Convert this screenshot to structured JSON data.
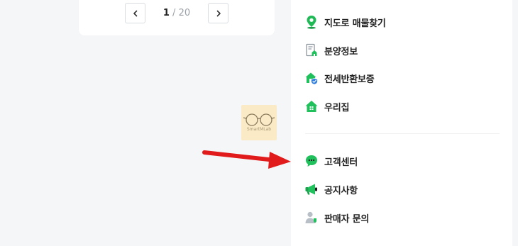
{
  "pagination": {
    "prev_icon": "chevron-left-icon",
    "next_icon": "chevron-right-icon",
    "current_page": "1",
    "separator_total": " / 20"
  },
  "watermark": {
    "text": "SmartMLab"
  },
  "menu": {
    "items": [
      {
        "label": "지도로 매물찾기",
        "icon": "map-pin-icon"
      },
      {
        "label": "분양정보",
        "icon": "building-doc-icon"
      },
      {
        "label": "전세반환보증",
        "icon": "house-shield-icon"
      },
      {
        "label": "우리집",
        "icon": "house-icon"
      },
      {
        "label": "고객센터",
        "icon": "chat-bubble-icon"
      },
      {
        "label": "공지사항",
        "icon": "megaphone-icon"
      },
      {
        "label": "판매자 문의",
        "icon": "seller-person-icon"
      }
    ]
  },
  "colors": {
    "accent_green": "#20c05c",
    "arrow_red": "#e11b1b",
    "background": "#f5f6f8"
  }
}
